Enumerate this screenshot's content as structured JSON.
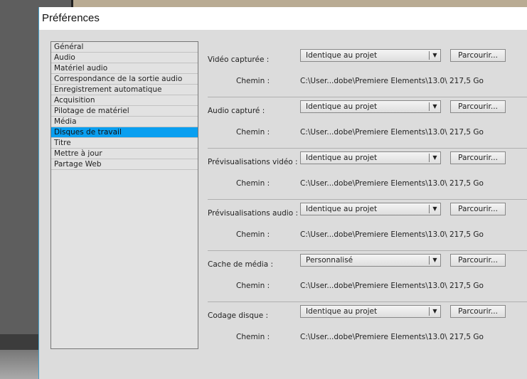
{
  "title": "Préférences",
  "sidebar": {
    "items": [
      "Général",
      "Audio",
      "Matériel audio",
      "Correspondance de la sortie audio",
      "Enregistrement automatique",
      "Acquisition",
      "Pilotage de matériel",
      "Média",
      "Disques de travail",
      "Titre",
      "Mettre à jour",
      "Partage Web"
    ],
    "selected_index": 8
  },
  "rows": [
    {
      "label": "Vidéo capturée :",
      "value": "Identique au projet",
      "browse": "Parcourir...",
      "path_label": "Chemin :",
      "path": "C:\\User...dobe\\Premiere Elements\\13.0\\",
      "size": "217,5 Go"
    },
    {
      "label": "Audio capturé :",
      "value": "Identique au projet",
      "browse": "Parcourir...",
      "path_label": "Chemin :",
      "path": "C:\\User...dobe\\Premiere Elements\\13.0\\",
      "size": "217,5 Go"
    },
    {
      "label": "Prévisualisations vidéo :",
      "value": "Identique au projet",
      "browse": "Parcourir...",
      "path_label": "Chemin :",
      "path": "C:\\User...dobe\\Premiere Elements\\13.0\\",
      "size": "217,5 Go"
    },
    {
      "label": "Prévisualisations audio :",
      "value": "Identique au projet",
      "browse": "Parcourir...",
      "path_label": "Chemin :",
      "path": "C:\\User...dobe\\Premiere Elements\\13.0\\",
      "size": "217,5 Go"
    },
    {
      "label": "Cache de média :",
      "value": "Personnalisé",
      "browse": "Parcourir...",
      "path_label": "Chemin :",
      "path": "C:\\User...dobe\\Premiere Elements\\13.0\\",
      "size": "217,5 Go"
    },
    {
      "label": "Codage disque :",
      "value": "Identique au projet",
      "browse": "Parcourir...",
      "path_label": "Chemin :",
      "path": "C:\\User...dobe\\Premiere Elements\\13.0\\",
      "size": "217,5 Go"
    }
  ],
  "colors": {
    "selection": "#0a9ff0"
  }
}
